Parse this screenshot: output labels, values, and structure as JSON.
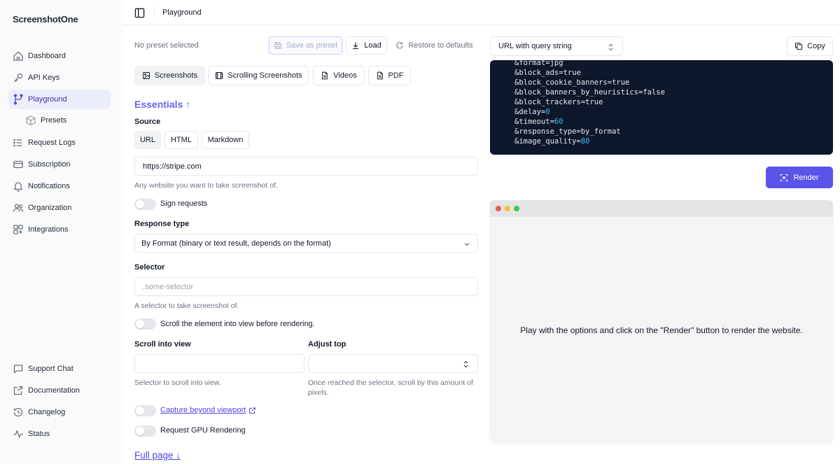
{
  "app": {
    "name": "ScreenshotOne"
  },
  "sidebar": {
    "items": [
      {
        "label": "Dashboard",
        "icon": "dashboard-icon"
      },
      {
        "label": "API Keys",
        "icon": "key-icon"
      },
      {
        "label": "Playground",
        "icon": "playground-icon",
        "active": true
      },
      {
        "label": "Presets",
        "icon": "cube-icon"
      },
      {
        "label": "Request Logs",
        "icon": "list-icon"
      },
      {
        "label": "Subscription",
        "icon": "card-icon"
      },
      {
        "label": "Notifications",
        "icon": "bell-icon"
      },
      {
        "label": "Organization",
        "icon": "users-icon"
      },
      {
        "label": "Integrations",
        "icon": "puzzle-icon"
      }
    ],
    "bottom_items": [
      {
        "label": "Support Chat",
        "icon": "chat-icon"
      },
      {
        "label": "Documentation",
        "icon": "external-link-icon"
      },
      {
        "label": "Changelog",
        "icon": "history-icon"
      },
      {
        "label": "Status",
        "icon": "activity-icon"
      }
    ]
  },
  "topbar": {
    "title": "Playground"
  },
  "form": {
    "preset_status": "No preset selected",
    "save_preset_label": "Save as preset",
    "load_label": "Load",
    "restore_label": "Restore to defaults",
    "tabs": [
      {
        "label": "Screenshots",
        "active": true
      },
      {
        "label": "Scrolling Screenshots"
      },
      {
        "label": "Videos"
      },
      {
        "label": "PDF"
      }
    ],
    "essentials_title": "Essentials ↑",
    "source_label": "Source",
    "source_options": [
      "URL",
      "HTML",
      "Markdown"
    ],
    "url_value": "https://stripe.com",
    "url_help": "Any website you want to take screenshot of.",
    "sign_requests_label": "Sign requests",
    "response_type_label": "Response type",
    "response_type_value": "By Format (binary or text result, depends on the format)",
    "selector_label": "Selector",
    "selector_placeholder": ".some-selector",
    "selector_help": "A selector to take screenshot of.",
    "scroll_element_label": "Scroll the element into view before rendering.",
    "scroll_into_view_label": "Scroll into view",
    "scroll_into_view_help": "Selector to scroll into view.",
    "adjust_top_label": "Adjust top",
    "adjust_top_help_1": "Once reached the selector, scroll by this amount of",
    "adjust_top_help_2": "pixels.",
    "capture_beyond_label": "Capture beyond viewport",
    "gpu_label": "Request GPU Rendering",
    "full_page_title": "Full page ↓"
  },
  "right": {
    "format_select": "URL with query string",
    "copy_label": "Copy",
    "code_lines": [
      {
        "key": "&format=",
        "value": "jpg",
        "numeric": false
      },
      {
        "key": "&block_ads=",
        "value": "true",
        "numeric": false
      },
      {
        "key": "&block_cookie_banners=",
        "value": "true",
        "numeric": false
      },
      {
        "key": "&block_banners_by_heuristics=",
        "value": "false",
        "numeric": false
      },
      {
        "key": "&block_trackers=",
        "value": "true",
        "numeric": false
      },
      {
        "key": "&delay=",
        "value": "0",
        "numeric": true
      },
      {
        "key": "&timeout=",
        "value": "60",
        "numeric": true
      },
      {
        "key": "&response_type=",
        "value": "by_format",
        "numeric": false
      },
      {
        "key": "&image_quality=",
        "value": "80",
        "numeric": true
      }
    ],
    "render_label": "Render",
    "preview_message": "Play with the options and click on the \"Render\" button to render the website."
  },
  "colors": {
    "accent": "#5b54e8",
    "essentials": "#6366f1",
    "code_bg": "#0f172a",
    "code_number": "#38bdf8",
    "traffic_red": "#f05b5b",
    "traffic_yellow": "#f5bd2f",
    "traffic_green": "#3ec84c"
  }
}
